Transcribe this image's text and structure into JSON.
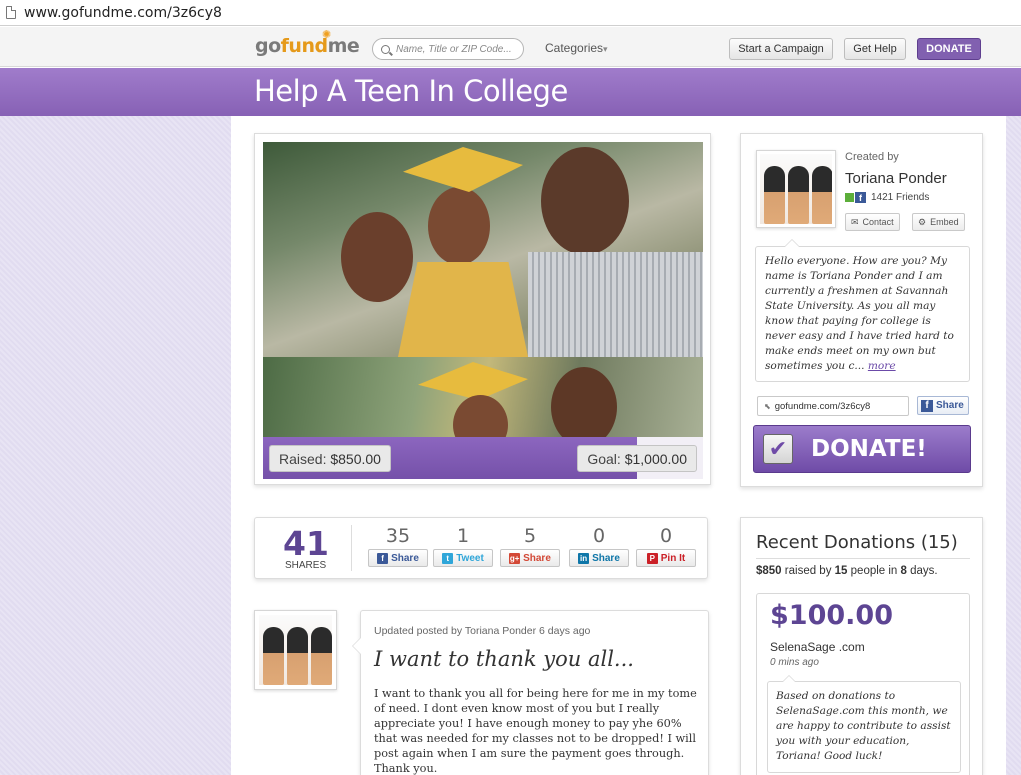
{
  "browser": {
    "url": "www.gofundme.com/3z6cy8"
  },
  "header": {
    "logo": {
      "go": "go",
      "fund": "fund",
      "me": "me"
    },
    "search_placeholder": "Name, Title or ZIP Code...",
    "categories_label": "Categories",
    "start_campaign": "Start a Campaign",
    "get_help": "Get Help",
    "donate": "DONATE"
  },
  "campaign": {
    "title": "Help A Teen In College",
    "raised_label": "Raised:",
    "raised_value": "$850.00",
    "goal_label": "Goal:",
    "goal_value": "$1,000.00",
    "progress_fraction": 0.85
  },
  "creator": {
    "created_by_label": "Created by",
    "name": "Toriana Ponder",
    "friends": "1421 Friends",
    "contact_label": "Contact",
    "embed_label": "Embed",
    "story": "Hello everyone. How are you? My name is Toriana Ponder and I am currently a freshmen at Savannah State University. As you all may know that paying for college is never easy and I have tried hard to make ends meet on my own but sometimes you c...",
    "more_label": "more",
    "short_url": "gofundme.com/3z6cy8",
    "fb_share_label": "Share",
    "donate_label": "DONATE!"
  },
  "shares": {
    "total": "41",
    "total_label": "SHARES",
    "networks": [
      {
        "count": "35",
        "label": "Share",
        "icon": "facebook-icon",
        "color": "#3b5998"
      },
      {
        "count": "1",
        "label": "Tweet",
        "icon": "twitter-icon",
        "color": "#2fa6d9"
      },
      {
        "count": "5",
        "label": "Share",
        "icon": "google-plus-icon",
        "color": "#d34836"
      },
      {
        "count": "0",
        "label": "Share",
        "icon": "linkedin-icon",
        "color": "#0e76a8"
      },
      {
        "count": "0",
        "label": "Pin It",
        "icon": "pinterest-icon",
        "color": "#cb2027"
      }
    ]
  },
  "recent": {
    "title": "Recent Donations (15)",
    "summary_a": "$850",
    "summary_b": " raised by ",
    "summary_c": "15",
    "summary_d": " people in ",
    "summary_e": "8",
    "summary_f": " days.",
    "donation": {
      "amount": "$100.00",
      "name": "SelenaSage .com",
      "time": "0 mins ago",
      "message": "Based on donations to SelenaSage.com this month, we are happy to contribute to assist you with your education, Toriana! Good luck!"
    }
  },
  "update": {
    "meta": "Updated posted by Toriana Ponder 6 days ago",
    "title": "I want to thank you all...",
    "body": "I want to thank you all for being here for me in my tome of need. I dont even know most of you but I really appreciate you! I have enough money to pay yhe 60% that was needed for my classes not to be dropped! I will post again when I am sure the payment goes through. Thank you."
  },
  "colors": {
    "brand_purple": "#8761b5",
    "accent_orange": "#e59a1b",
    "donate_purple": "#6f4ba7"
  }
}
